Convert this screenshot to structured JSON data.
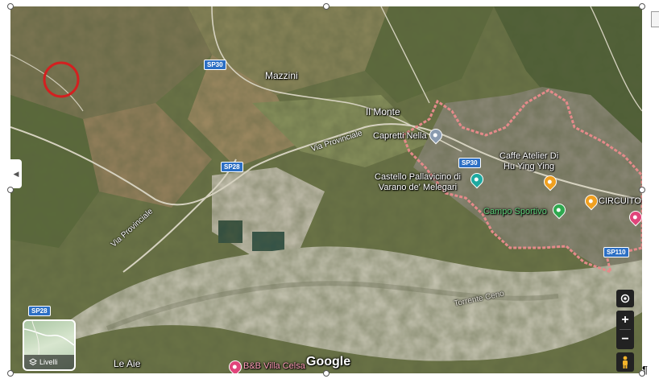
{
  "map": {
    "places": {
      "mazzini": "Mazzini",
      "il_monte": "Il Monte",
      "capretti_nella": "Capretti Nella",
      "castello": "Castello Pallavicino di\nVarano de' Melegari",
      "caffe": "Caffe Atelier Di\nHu Ying Ying",
      "circuito": "CIRCUITO",
      "campo_sportivo": "Campo Sportivo",
      "torrente_ceno": "Torrente Ceno",
      "le_aie": "Le Aie",
      "bb": "B&B Villa Celsa"
    },
    "roads": {
      "sp30_a": "SP30",
      "sp30_b": "SP30",
      "sp28_a": "SP28",
      "sp28_b": "SP28",
      "sp110": "SP110",
      "via_provinciale_1": "Via Provinciale",
      "via_provinciale_2": "Via Provinciale"
    },
    "attribution": "Google",
    "layers_label": "Livelli",
    "zoom_in": "+",
    "zoom_out": "−",
    "pilcrow": "¶"
  }
}
